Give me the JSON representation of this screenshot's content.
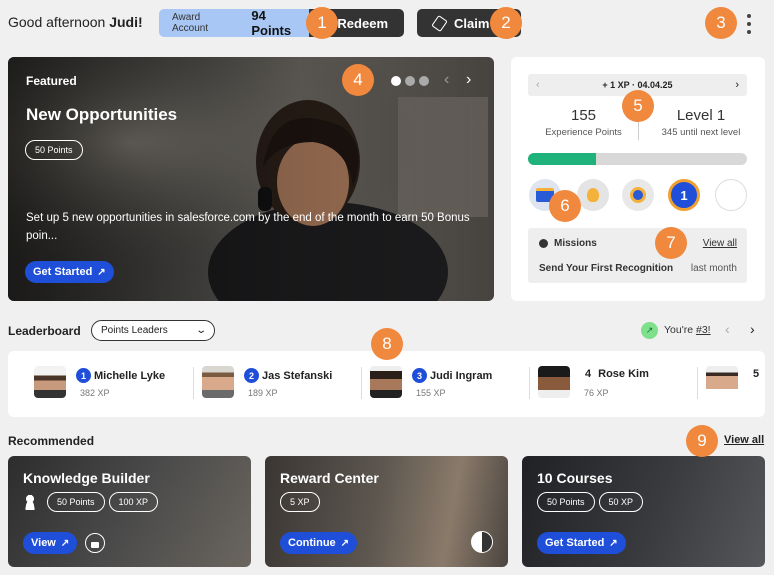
{
  "header": {
    "greeting_prefix": "Good afternoon ",
    "user_name": "Judi!",
    "award_account_label": "Award Account",
    "points": "94 Points",
    "redeem_label": "Redeem",
    "claim_label": "Claim"
  },
  "markers": [
    "1",
    "2",
    "3",
    "4",
    "5",
    "6",
    "7",
    "8",
    "9"
  ],
  "featured": {
    "kicker": "Featured",
    "title": "New Opportunities",
    "points_pill": "50 Points",
    "description": "Set up 5 new opportunities in salesforce.com by the end of the month to earn 50 Bonus poin...",
    "cta": "Get Started",
    "carousel_dots": 3,
    "active_dot": 0
  },
  "xp_panel": {
    "date_nav": "+ 1 XP · 04.04.25",
    "xp_value": "155",
    "xp_label": "Experience Points",
    "level": "Level 1",
    "level_sub": "345 until next level",
    "progress_fraction": 0.31,
    "badge_number": "1"
  },
  "missions": {
    "title": "Missions",
    "view_all": "View all",
    "item": "Send Your First Recognition",
    "item_time": "last month"
  },
  "leaderboard": {
    "title": "Leaderboard",
    "filter": "Points Leaders",
    "you_text": "You're ",
    "you_rank": "#3!",
    "entries": [
      {
        "rank": "1",
        "name": "Michelle Lyke",
        "xp": "382 XP"
      },
      {
        "rank": "2",
        "name": "Jas Stefanski",
        "xp": "189 XP"
      },
      {
        "rank": "3",
        "name": "Judi Ingram",
        "xp": "155 XP"
      },
      {
        "rank": "4",
        "name": "Rose Kim",
        "xp": "76 XP"
      },
      {
        "rank": "5",
        "name": "",
        "xp": ""
      }
    ]
  },
  "recommended": {
    "title": "Recommended",
    "view_all": "View all",
    "cards": [
      {
        "title": "Knowledge Builder",
        "pills": [
          "50 Points",
          "100 XP"
        ],
        "cta": "View"
      },
      {
        "title": "Reward Center",
        "pills": [
          "5 XP"
        ],
        "cta": "Continue"
      },
      {
        "title": "10 Courses",
        "pills": [
          "50 Points",
          "50 XP"
        ],
        "cta": "Get Started"
      }
    ]
  },
  "colors": {
    "accent_blue": "#1f4fd8",
    "progress_green": "#1fb27a",
    "marker_orange": "#f0883e",
    "award_pill_blue": "#a9c7f5",
    "dark_button": "#333333"
  }
}
